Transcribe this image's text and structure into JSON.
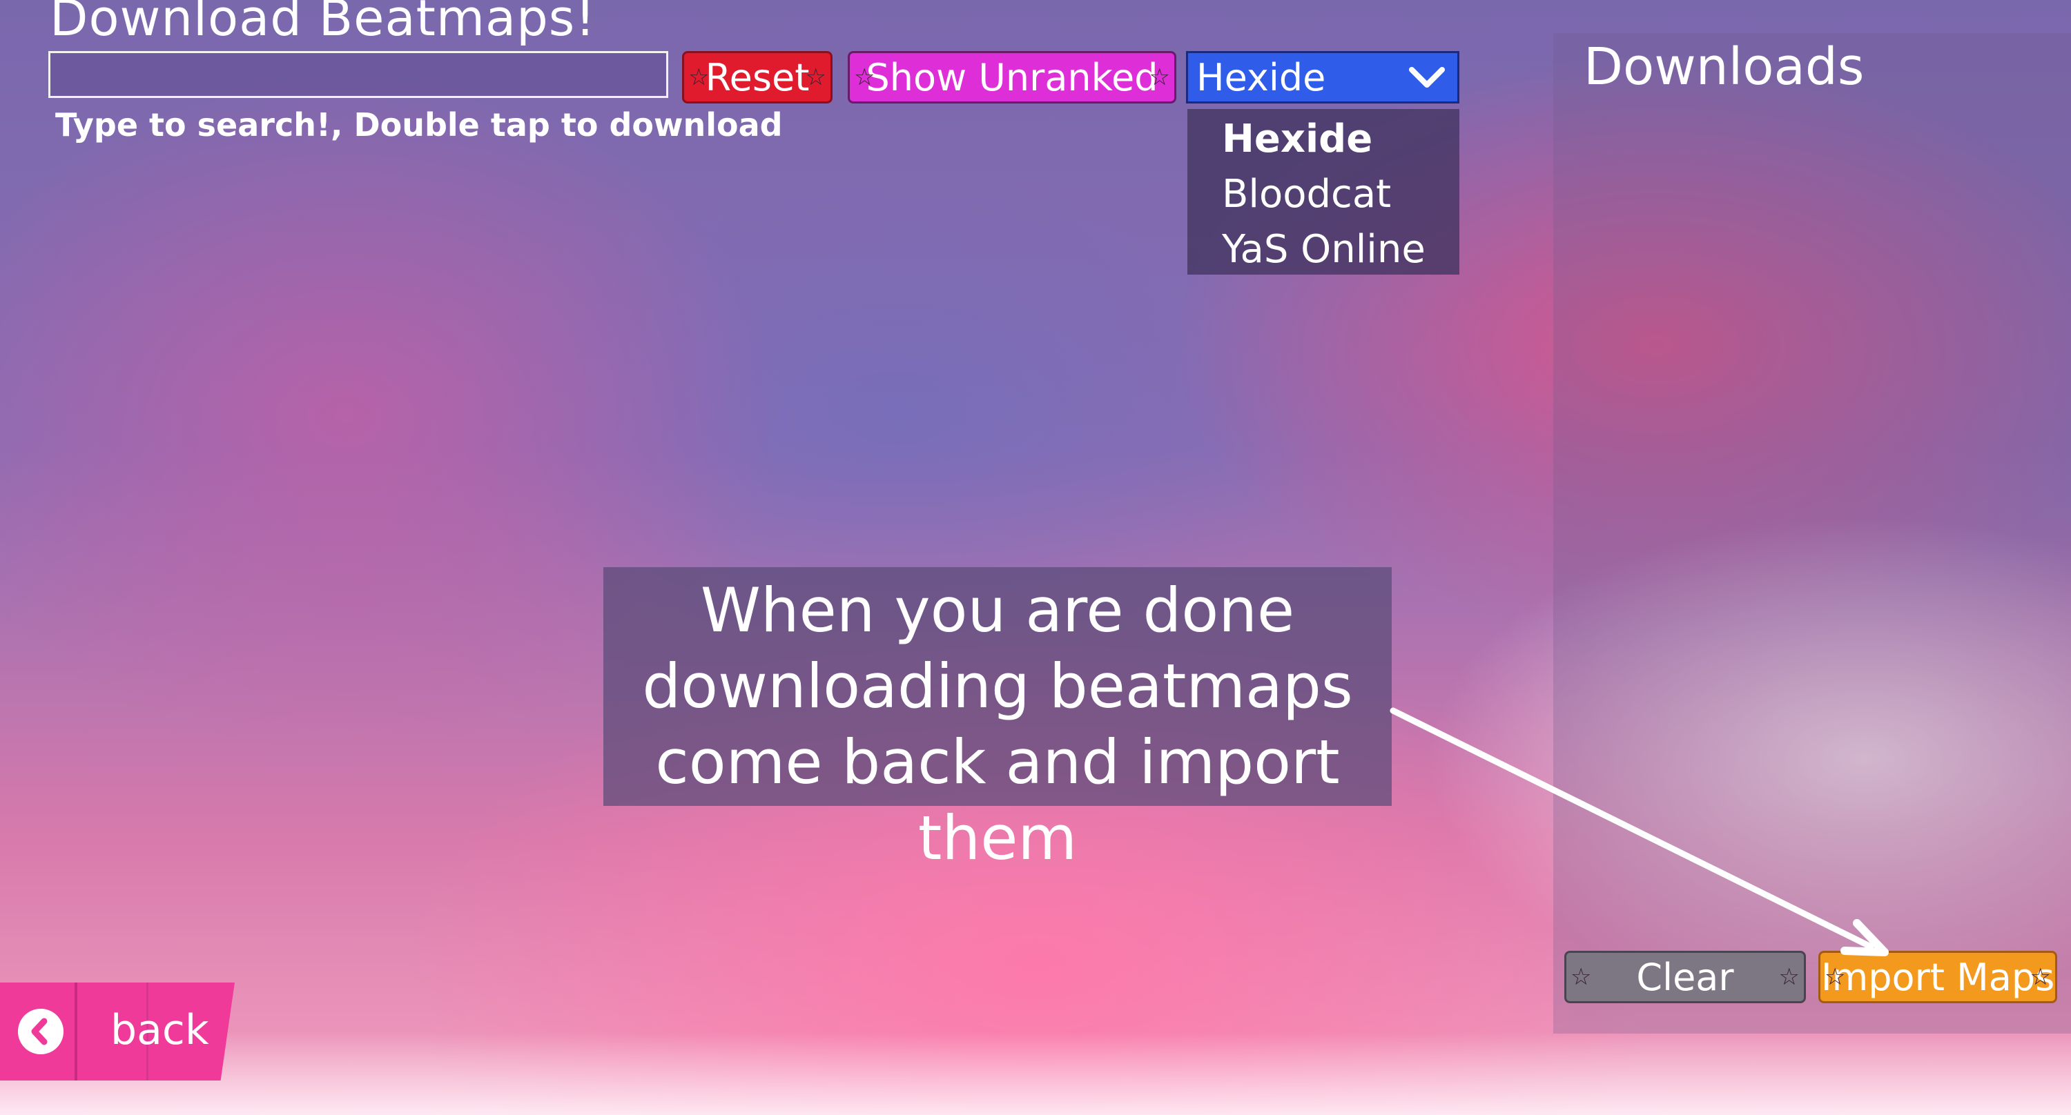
{
  "header": {
    "title": "Download Beatmaps!",
    "search_placeholder": "",
    "hint": "Type to search!, Double tap to download"
  },
  "toolbar": {
    "reset_label": "Reset",
    "show_unranked_label": "Show Unranked"
  },
  "source_select": {
    "selected": "Hexide",
    "options": [
      "Hexide",
      "Bloodcat",
      "YaS Online"
    ]
  },
  "downloads": {
    "title": "Downloads",
    "clear_label": "Clear",
    "import_label": "Import Maps"
  },
  "callout": {
    "lines": [
      "When you are done",
      "downloading beatmaps",
      "come back and import them"
    ]
  },
  "nav": {
    "back_label": "back"
  },
  "colors": {
    "reset": "#e11b2e",
    "unranked": "#de2ed8",
    "select": "#2f5ce8",
    "import": "#f39a1e",
    "back": "#f03a9a"
  }
}
